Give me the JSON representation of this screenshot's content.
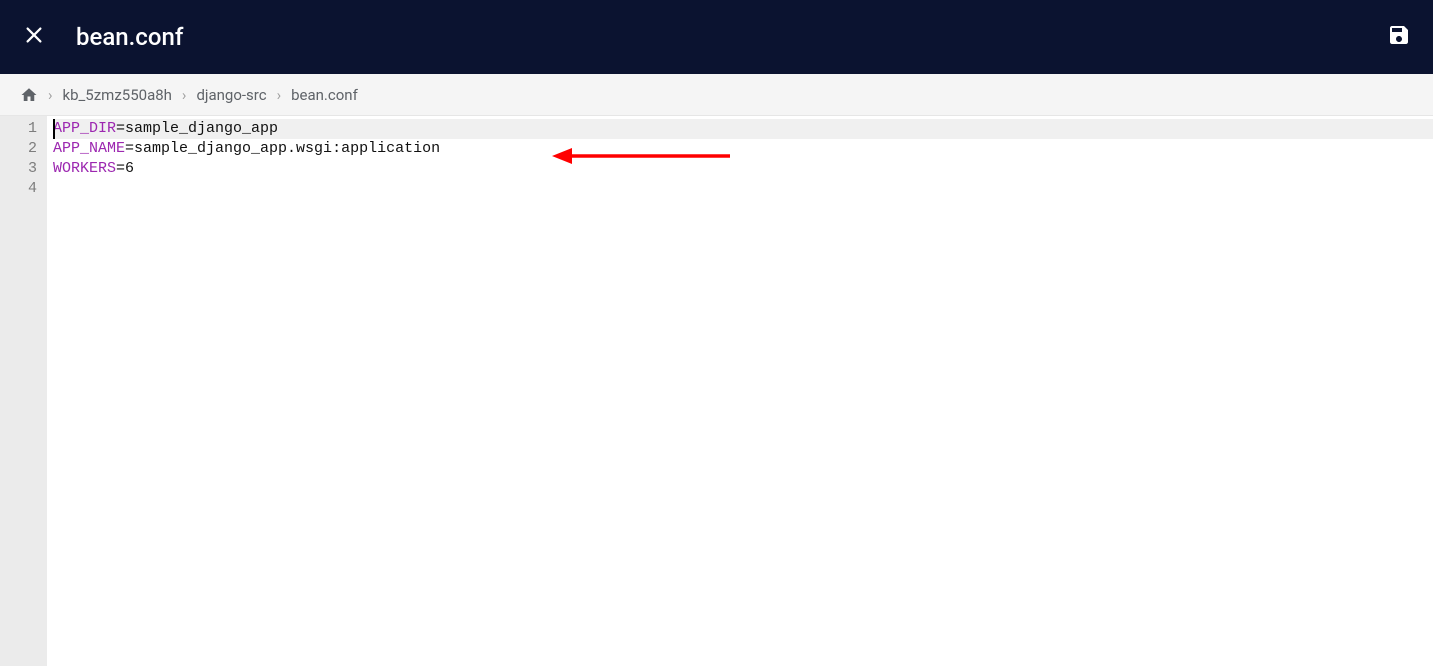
{
  "header": {
    "title": "bean.conf"
  },
  "breadcrumb": {
    "items": [
      "kb_5zmz550a8h",
      "django-src",
      "bean.conf"
    ]
  },
  "editor": {
    "lines": [
      {
        "key": "APP_DIR",
        "value": "sample_django_app"
      },
      {
        "key": "APP_NAME",
        "value": "sample_django_app.wsgi:application"
      },
      {
        "key": "WORKERS",
        "value": "6"
      },
      {
        "key": "",
        "value": ""
      }
    ],
    "line_numbers": [
      "1",
      "2",
      "3",
      "4"
    ],
    "cursor_line": 1
  }
}
